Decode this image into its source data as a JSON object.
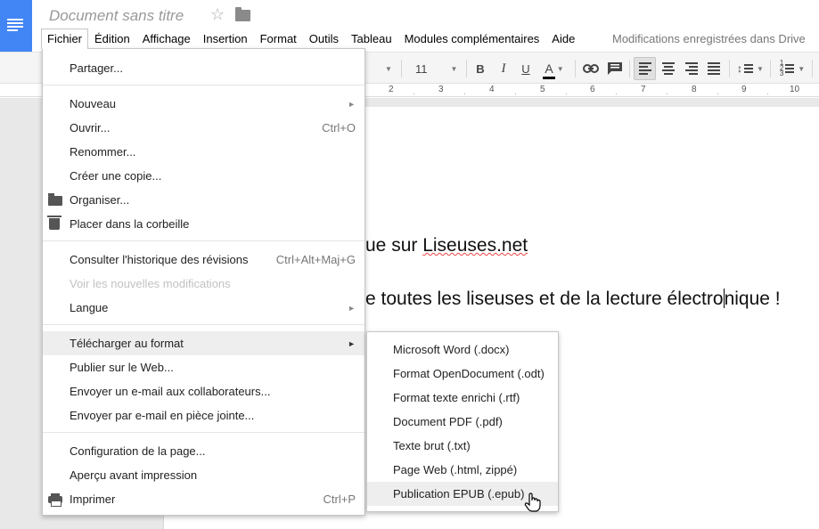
{
  "header": {
    "doc_title": "Document sans titre",
    "save_status": "Modifications enregistrées dans Drive"
  },
  "menubar": [
    {
      "label": "Fichier",
      "name": "menu-fichier",
      "active": true
    },
    {
      "label": "Édition",
      "name": "menu-edition"
    },
    {
      "label": "Affichage",
      "name": "menu-affichage"
    },
    {
      "label": "Insertion",
      "name": "menu-insertion"
    },
    {
      "label": "Format",
      "name": "menu-format"
    },
    {
      "label": "Outils",
      "name": "menu-outils"
    },
    {
      "label": "Tableau",
      "name": "menu-tableau"
    },
    {
      "label": "Modules complémentaires",
      "name": "menu-modules"
    },
    {
      "label": "Aide",
      "name": "menu-aide"
    }
  ],
  "toolbar": {
    "font_size": "11",
    "bold": "B",
    "italic": "I",
    "underline": "U",
    "text_color": "A",
    "text_color_value": "#000000"
  },
  "ruler": [
    "2",
    "3",
    "4",
    "5",
    "6",
    "7",
    "8",
    "9",
    "10"
  ],
  "document": {
    "line1_prefix": "ue sur ",
    "line1_link": "Liseuses.net",
    "line2_a": "e toutes les liseuses et de la lecture électro",
    "line2_b": "nique !"
  },
  "file_menu": {
    "items": {
      "share": "Partager...",
      "new": "Nouveau",
      "open": "Ouvrir...",
      "open_shortcut": "Ctrl+O",
      "rename": "Renommer...",
      "copy": "Créer une copie...",
      "organize": "Organiser...",
      "trash": "Placer dans la corbeille",
      "history": "Consulter l'historique des révisions",
      "history_shortcut": "Ctrl+Alt+Maj+G",
      "new_changes": "Voir les nouvelles modifications",
      "language": "Langue",
      "download": "Télécharger au format",
      "publish": "Publier sur le Web...",
      "email_collab": "Envoyer un e-mail aux collaborateurs...",
      "email_attach": "Envoyer par e-mail en pièce jointe...",
      "page_setup": "Configuration de la page...",
      "print_preview": "Aperçu avant impression",
      "print": "Imprimer",
      "print_shortcut": "Ctrl+P"
    }
  },
  "download_submenu": [
    "Microsoft Word (.docx)",
    "Format OpenDocument (.odt)",
    "Format texte enrichi (.rtf)",
    "Document PDF (.pdf)",
    "Texte brut (.txt)",
    "Page Web (.html, zippé)",
    "Publication EPUB (.epub)"
  ],
  "colors": {
    "brand_blue": "#4285f4",
    "menu_highlight": "#eeeeee",
    "disabled_text": "#c2c2c2"
  }
}
